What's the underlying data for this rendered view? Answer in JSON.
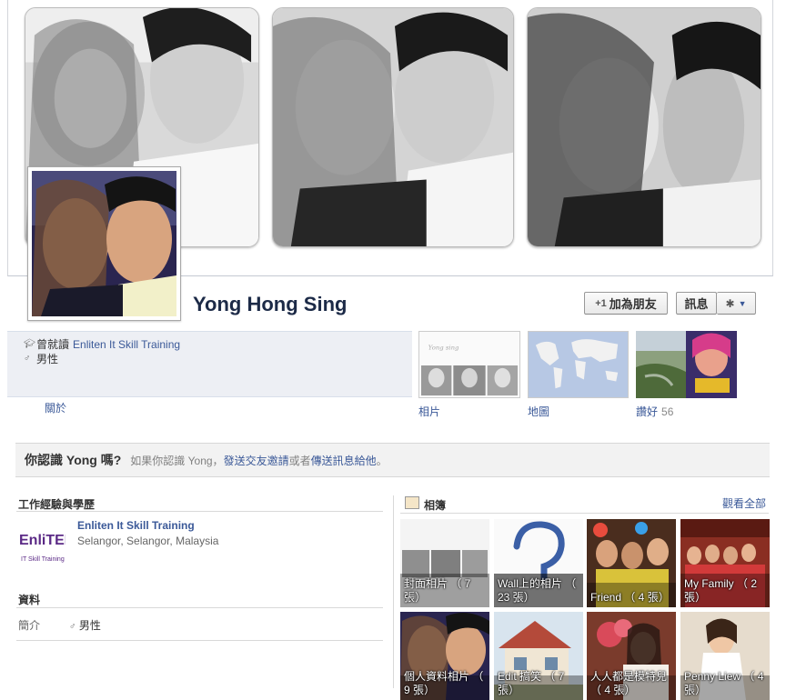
{
  "profile": {
    "name": "Yong Hong Sing",
    "add_friend_label": "加為朋友",
    "message_label": "訊息",
    "settings_icon": "gear-icon"
  },
  "info": {
    "studied_prefix": "曾就讀",
    "school": "Enliten It Skill Training",
    "gender": "男性",
    "about_link": "關於"
  },
  "tiles": [
    {
      "label": "相片",
      "count": ""
    },
    {
      "label": "地圖",
      "count": ""
    },
    {
      "label": "讚好",
      "count": "56"
    }
  ],
  "know_banner": {
    "title": "你認識 Yong 嗎?",
    "text_prefix": "如果你認識 Yong，",
    "link1": "發送交友邀請",
    "middle": "或者",
    "link2": "傳送訊息給他",
    "suffix": "。"
  },
  "work_section": {
    "title": "工作經驗與學歷",
    "logo_text_top": "EnliTEN",
    "logo_text_bottom": "IT Skill Training",
    "name": "Enliten It Skill Training",
    "location": "Selangor, Selangor, Malaysia"
  },
  "info_section": {
    "title": "資料",
    "row_label": "簡介",
    "row_value": "男性"
  },
  "albums": {
    "title": "相簿",
    "see_all": "觀看全部",
    "items": [
      {
        "caption": "封面相片 （ 7 張）"
      },
      {
        "caption": "Wall上的相片 （ 23 張）"
      },
      {
        "caption": "Friend （ 4 張）"
      },
      {
        "caption": "My Family （ 2 張）"
      },
      {
        "caption": "個人資料相片 （ 9 張）"
      },
      {
        "caption": "Edit 搞笑 （ 7 張）"
      },
      {
        "caption": "人人都是模特兒 （ 4 張）"
      },
      {
        "caption": "Penny Liew （ 4 張）"
      }
    ]
  },
  "colors": {
    "link": "#3b5998",
    "info_band": "#edeff4",
    "name": "#1c2a47"
  }
}
